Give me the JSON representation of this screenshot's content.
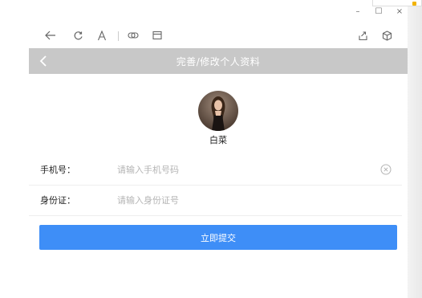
{
  "window": {
    "badge_label": "",
    "controls": {
      "minimize": "–",
      "maximize": "☐",
      "close": "×"
    }
  },
  "toolbar": {
    "icons": [
      "back-icon",
      "refresh-icon",
      "font-icon",
      "link-icon",
      "window-icon",
      "share-icon",
      "cube-icon"
    ]
  },
  "header": {
    "title": "完善/修改个人资料"
  },
  "profile": {
    "name": "白菜"
  },
  "form": {
    "phone": {
      "label": "手机号：",
      "placeholder": "请输入手机号码",
      "value": ""
    },
    "id_card": {
      "label": "身份证：",
      "placeholder": "请输入身份证号",
      "value": ""
    }
  },
  "submit": {
    "label": "立即提交"
  },
  "colors": {
    "header_bg": "#c8c8c8",
    "primary": "#3e8ef7"
  }
}
